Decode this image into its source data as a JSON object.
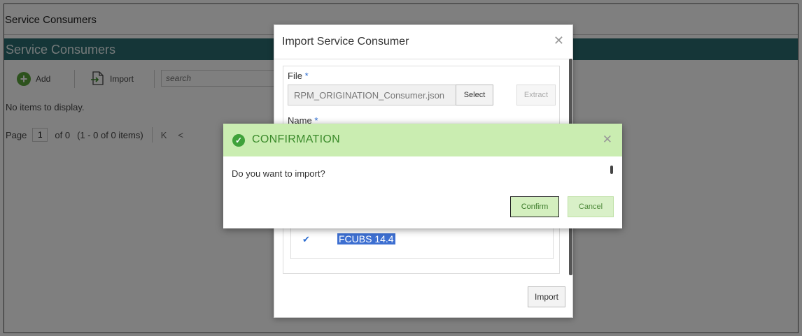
{
  "window": {
    "title": "Service Consumers"
  },
  "header": {
    "title": "Service Consumers"
  },
  "toolbar": {
    "add_label": "Add",
    "import_label": "Import",
    "search_placeholder": "search"
  },
  "list": {
    "empty_message": "No items to display."
  },
  "pager": {
    "page_label": "Page",
    "page_value": "1",
    "of_total": "of 0",
    "items_summary": "(1 - 0 of 0 items)",
    "first_icon": "K",
    "prev_icon": "<"
  },
  "import_dialog": {
    "title": "Import Service Consumer",
    "file_label": "File",
    "file_value": "RPM_ORIGINATION_Consumer.json",
    "select_label": "Select",
    "extract_label": "Extract",
    "name_label": "Name",
    "required_mark": "*",
    "list_item": "FCUBS 14.4",
    "import_label": "Import"
  },
  "confirm_dialog": {
    "title": "CONFIRMATION",
    "message": "Do you want to import?",
    "confirm_label": "Confirm",
    "cancel_label": "Cancel"
  },
  "colors": {
    "header_bg": "#2b6c71",
    "confirm_header_bg": "#caedb1",
    "success_green": "#3fa23a",
    "selection_blue": "#3d6fd1"
  },
  "icons": {
    "add": "plus-circle-icon",
    "import": "import-file-icon",
    "close": "close-icon",
    "confirm": "check-circle-icon",
    "checkbox": "checkmark-icon"
  }
}
